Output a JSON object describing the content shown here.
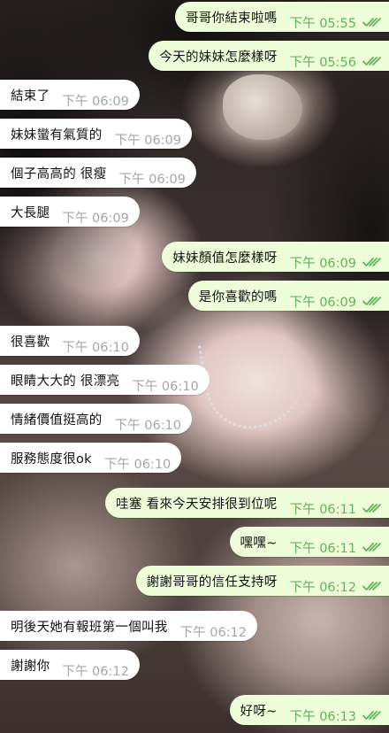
{
  "colors": {
    "incoming_bubble": "#ffffff",
    "outgoing_bubble": "#eefed9",
    "outgoing_time": "#64b25a",
    "incoming_time": "#a7a7a7",
    "read_ticks": "#64b25a"
  },
  "messages": [
    {
      "direction": "out",
      "text": "哥哥你結束啦嗎",
      "time": "下午 05:55",
      "read": true
    },
    {
      "direction": "out",
      "text": "今天的妹妹怎麼樣呀",
      "time": "下午 05:56",
      "read": true
    },
    {
      "direction": "in",
      "text": "結束了",
      "time": "下午 06:09"
    },
    {
      "direction": "in",
      "text": "妹妹蠻有氣質的",
      "time": "下午 06:09"
    },
    {
      "direction": "in",
      "text": "個子高高的 很瘦",
      "time": "下午 06:09"
    },
    {
      "direction": "in",
      "text": "大長腿",
      "time": "下午 06:09"
    },
    {
      "direction": "out",
      "text": "妹妹顏值怎麼樣呀",
      "time": "下午 06:09",
      "read": true
    },
    {
      "direction": "out",
      "text": "是你喜歡的嗎",
      "time": "下午 06:09",
      "read": true
    },
    {
      "direction": "in",
      "text": "很喜歡",
      "time": "下午 06:10"
    },
    {
      "direction": "in",
      "text": "眼睛大大的 很漂亮",
      "time": "下午 06:10"
    },
    {
      "direction": "in",
      "text": "情緒價值挺高的",
      "time": "下午 06:10"
    },
    {
      "direction": "in",
      "text": "服務態度很ok",
      "time": "下午 06:10"
    },
    {
      "direction": "out",
      "text": "哇塞 看來今天安排很到位呢",
      "time": "下午 06:11",
      "read": true
    },
    {
      "direction": "out",
      "text": "嘿嘿~",
      "time": "下午 06:11",
      "read": true
    },
    {
      "direction": "out",
      "text": "謝謝哥哥的信任支持呀",
      "time": "下午 06:12",
      "read": true
    },
    {
      "direction": "in",
      "text": "明後天她有報班第一個叫我",
      "time": "下午 06:12"
    },
    {
      "direction": "in",
      "text": "謝謝你",
      "time": "下午 06:12"
    },
    {
      "direction": "out",
      "text": "好呀~",
      "time": "下午 06:13",
      "read": true
    }
  ]
}
